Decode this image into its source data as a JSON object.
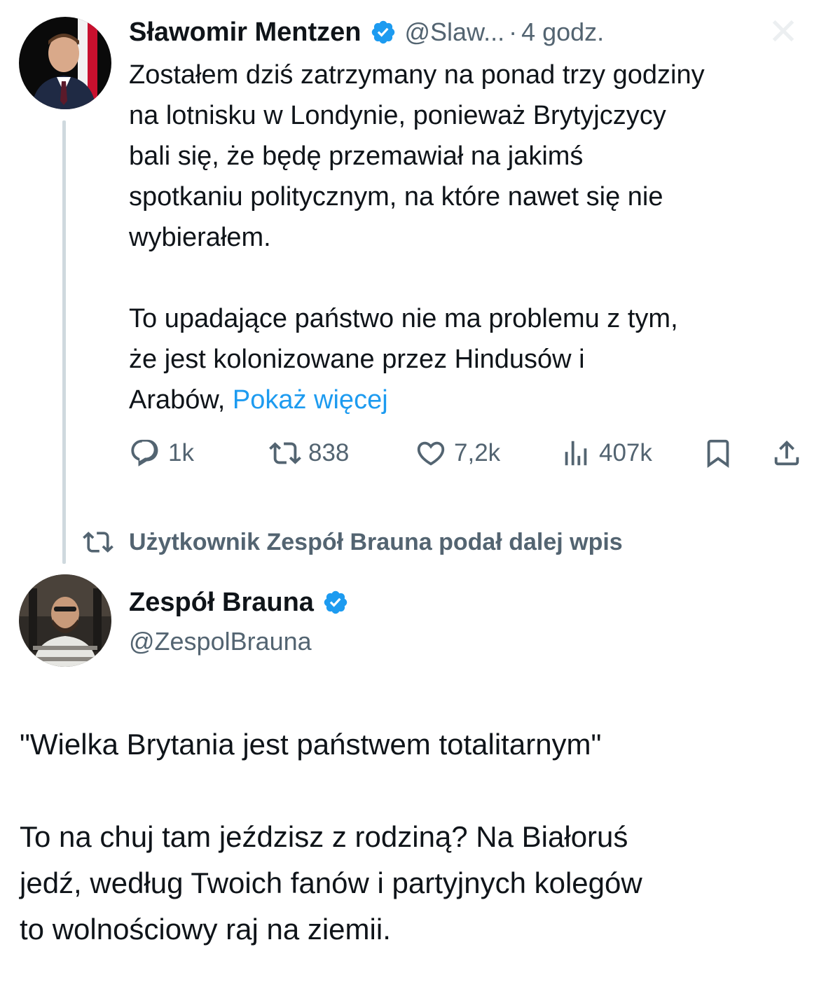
{
  "tweet": {
    "author_name": "Sławomir Mentzen",
    "handle": "@Slaw...",
    "separator": "·",
    "time": "4 godz.",
    "text": "Zostałem dziś zatrzymany na ponad trzy godziny\nna lotnisku w Londynie, ponieważ Brytyjczycy\nbali się, że będę przemawiał na jakimś\nspotkaniu politycznym, na które nawet się nie\nwybierałem.\n\nTo upadające państwo nie ma problemu z tym,\nże jest kolonizowane przez Hindusów i\nArabów, ",
    "show_more": "Pokaż więcej",
    "stats": {
      "replies": "1k",
      "reposts": "838",
      "likes": "7,2k",
      "views": "407k"
    }
  },
  "retweet_note": "Użytkownik Zespół Brauna podał dalej wpis",
  "quote": {
    "author_name": "Zespół Brauna",
    "handle": "@ZespolBrauna",
    "text": "\"Wielka Brytania jest państwem totalitarnym\"\n\nTo na chuj tam jeździsz z rodziną? Na Białoruś\njedź, według Twoich fanów i partyjnych kolegów\nto wolnościowy raj na ziemii."
  },
  "icons": {
    "verified": "verified-badge-icon",
    "reply": "reply-icon",
    "retweet": "retweet-icon",
    "like": "heart-icon",
    "views": "views-icon",
    "bookmark": "bookmark-icon",
    "share": "share-icon",
    "close": "close-icon"
  },
  "colors": {
    "text": "#0f1419",
    "secondary": "#536471",
    "link": "#1d9bf0",
    "verified": "#1d9bf0",
    "thread_line": "#cfd9de"
  }
}
